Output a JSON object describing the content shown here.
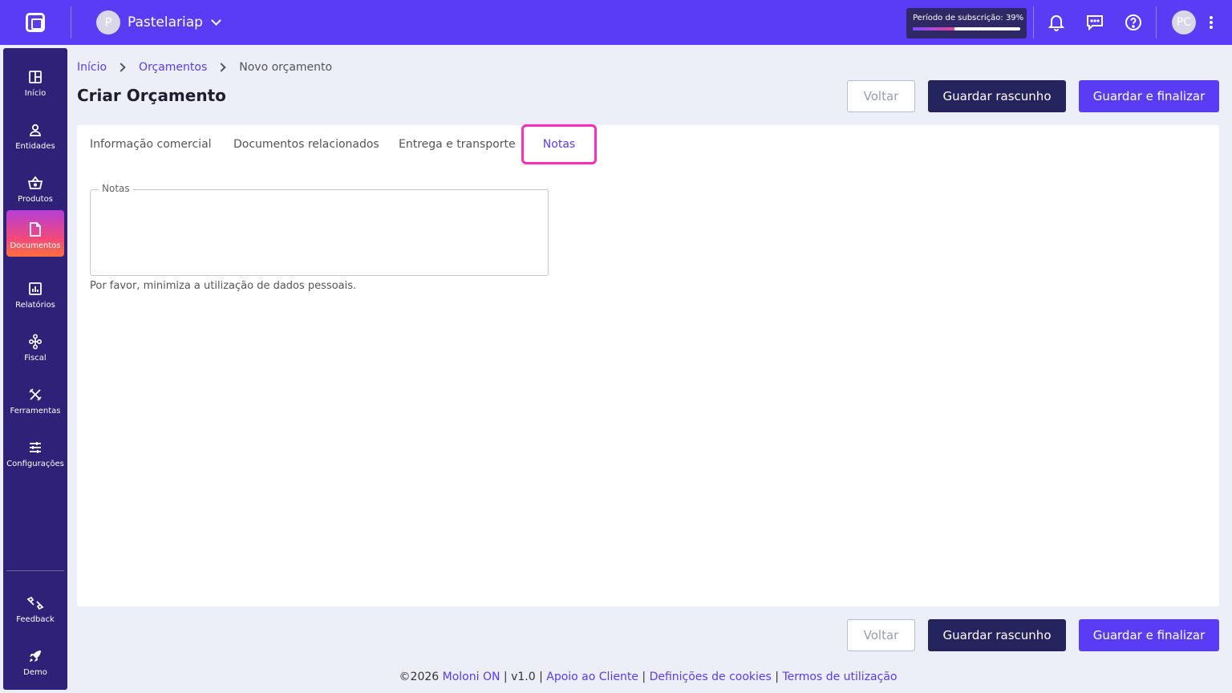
{
  "company": {
    "initial": "P",
    "name": "Pastelariap"
  },
  "subscription": {
    "label": "Período de subscrição: 39%",
    "progress_percent": 39
  },
  "user": {
    "initials": "PC"
  },
  "sidebar": {
    "items": [
      {
        "label": "Início",
        "icon": "grid-icon"
      },
      {
        "label": "Entidades",
        "icon": "person-icon"
      },
      {
        "label": "Produtos",
        "icon": "basket-icon"
      },
      {
        "label": "Documentos",
        "icon": "document-icon"
      },
      {
        "label": "Relatórios",
        "icon": "chart-icon"
      },
      {
        "label": "Fiscal",
        "icon": "hierarchy-icon"
      },
      {
        "label": "Ferramentas",
        "icon": "tools-icon"
      },
      {
        "label": "Configurações",
        "icon": "sliders-icon"
      }
    ],
    "bottom_items": [
      {
        "label": "Feedback",
        "icon": "feedback-icon"
      },
      {
        "label": "Demo",
        "icon": "rocket-icon"
      }
    ]
  },
  "breadcrumb": {
    "home": "Início",
    "section": "Orçamentos",
    "current": "Novo orçamento"
  },
  "page": {
    "title": "Criar Orçamento"
  },
  "actions": {
    "back": "Voltar",
    "save_draft": "Guardar rascunho",
    "save_finalize": "Guardar e finalizar"
  },
  "tabs": [
    {
      "label": "Informação comercial"
    },
    {
      "label": "Documentos relacionados"
    },
    {
      "label": "Entrega e transporte"
    },
    {
      "label": "Notas"
    }
  ],
  "notes": {
    "label": "Notas",
    "value": "",
    "helper": "Por favor, minimiza a utilização de dados pessoais."
  },
  "footer": {
    "copyright": "©2026",
    "brand": "Moloni ON",
    "version": "v1.0",
    "support": "Apoio ao Cliente",
    "cookies": "Definições de cookies",
    "terms": "Termos de utilização"
  },
  "colors": {
    "accent": "#5a3cf5",
    "sidebar": "#2e2177",
    "dark_button": "#25235e",
    "tab_highlight": "#ff2dbe"
  }
}
